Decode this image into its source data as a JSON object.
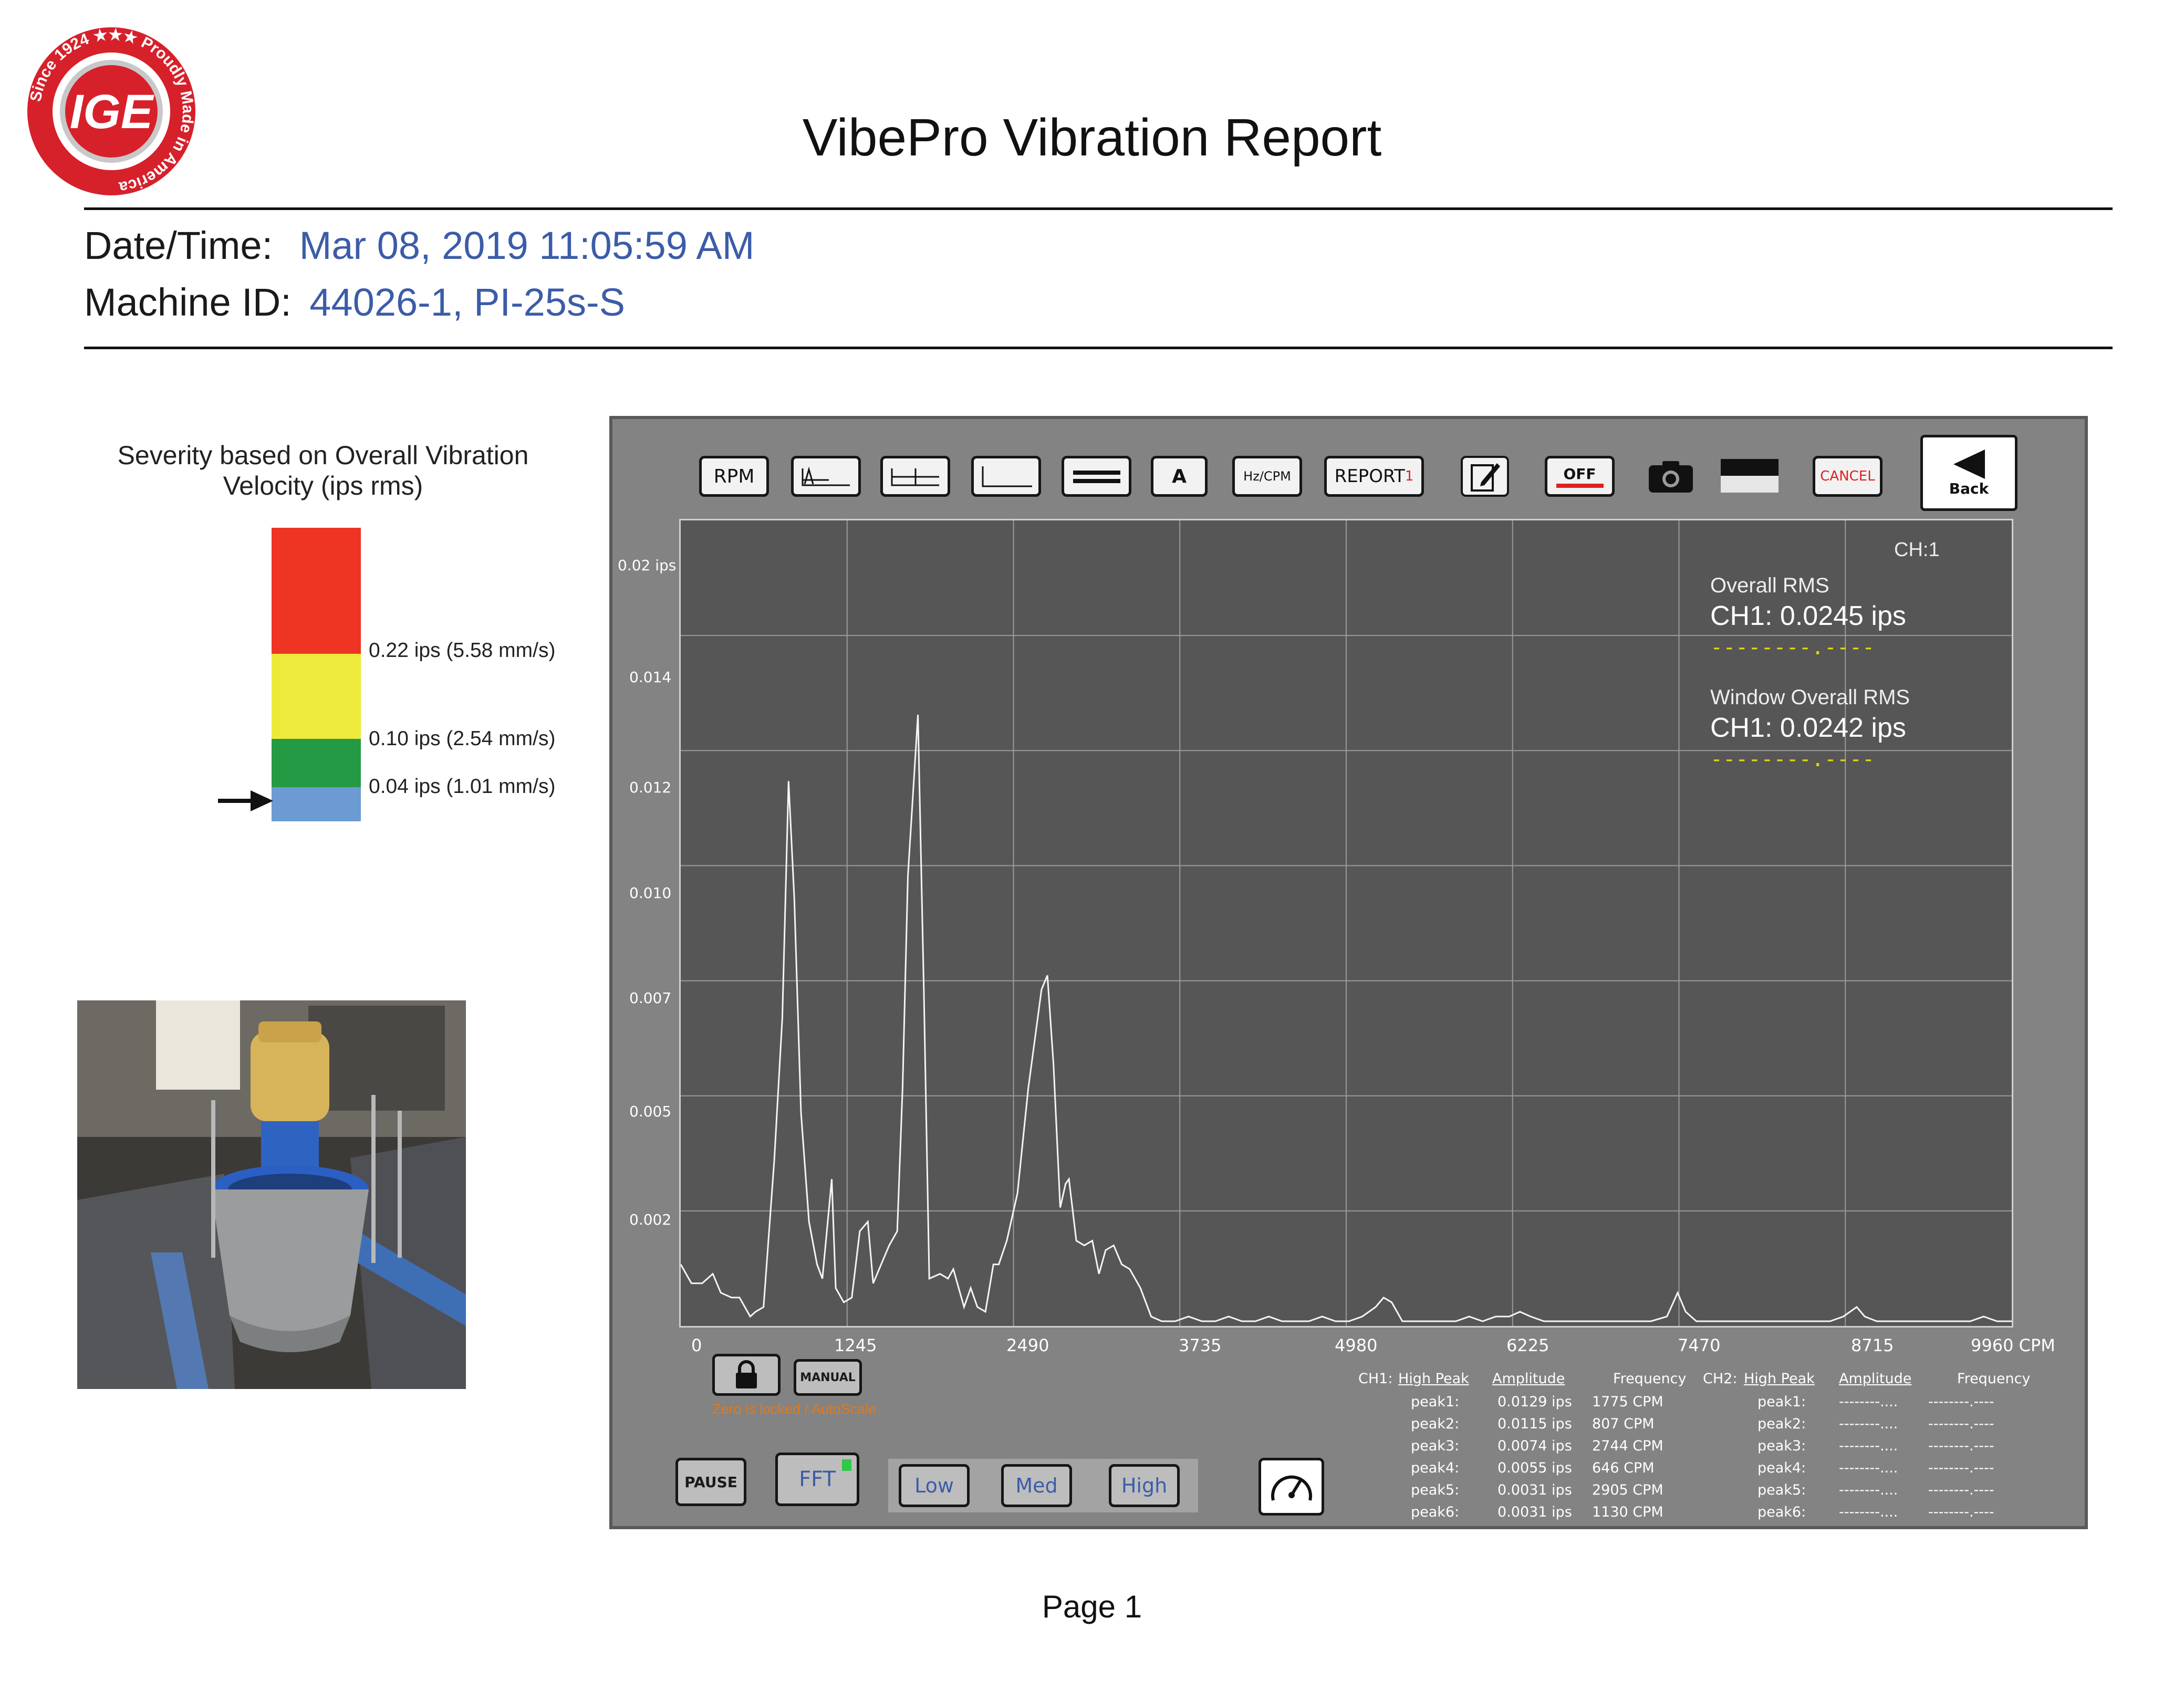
{
  "logo": {
    "brand": "IGE",
    "ring_text": "Since 1924 ★★★ Proudly Made in America"
  },
  "title": "VibePro Vibration Report",
  "meta": {
    "date_label": "Date/Time:",
    "date_value": "Mar 08, 2019  11:05:59 AM",
    "machine_label": "Machine ID:",
    "machine_value": "44026-1, PI-25s-S"
  },
  "severity": {
    "title": "Severity based on Overall Vibration Velocity (ips rms)",
    "thresholds": [
      {
        "label": "0.22 ips (5.58 mm/s)"
      },
      {
        "label": "0.10 ips (2.54 mm/s)"
      },
      {
        "label": "0.04 ips (1.01 mm/s)"
      }
    ],
    "colors": {
      "red": "#ee3423",
      "yellow": "#eeea3c",
      "green": "#249a45",
      "blue": "#6b9bd2"
    },
    "current_band": "blue"
  },
  "toolbar": {
    "rpm": "RPM",
    "a": "A",
    "hzcpm": "Hz/CPM",
    "report": "REPORT",
    "report_badge": "1",
    "off": "OFF",
    "cancel": "CANCEL",
    "back": "Back"
  },
  "overlay": {
    "ch": "CH:1",
    "overall_title": "Overall RMS",
    "overall_value": "CH1:  0.0245 ips",
    "overall_dash": "--------.----",
    "window_title": "Window Overall RMS",
    "window_value": "CH1:  0.0242 ips",
    "window_dash": "--------.----"
  },
  "chart_data": {
    "type": "line",
    "title": "",
    "xlabel": "",
    "ylabel": "",
    "x_unit": "CPM",
    "y_unit": "ips",
    "xlim": [
      0,
      9960
    ],
    "ylim": [
      0,
      0.017
    ],
    "x_ticks": [
      "0",
      "1245",
      "2490",
      "3735",
      "4980",
      "6225",
      "7470",
      "8715",
      "9960 CPM"
    ],
    "y_ticks": [
      "0.02 ips",
      "0.014",
      "0.012",
      "0.010",
      "0.007",
      "0.005",
      "0.002"
    ],
    "series": [
      {
        "values": [
          [
            0,
            0.0013
          ],
          [
            80,
            0.0009
          ],
          [
            160,
            0.0009
          ],
          [
            240,
            0.0011
          ],
          [
            300,
            0.0007
          ],
          [
            380,
            0.0006
          ],
          [
            440,
            0.0006
          ],
          [
            520,
            0.0002
          ],
          [
            560,
            0.0003
          ],
          [
            620,
            0.0004
          ],
          [
            700,
            0.0035
          ],
          [
            760,
            0.0065
          ],
          [
            807,
            0.0115
          ],
          [
            850,
            0.009
          ],
          [
            900,
            0.0045
          ],
          [
            960,
            0.0022
          ],
          [
            1020,
            0.0013
          ],
          [
            1060,
            0.001
          ],
          [
            1130,
            0.0031
          ],
          [
            1160,
            0.0008
          ],
          [
            1220,
            0.0005
          ],
          [
            1280,
            0.0006
          ],
          [
            1340,
            0.002
          ],
          [
            1400,
            0.0022
          ],
          [
            1440,
            0.0009
          ],
          [
            1500,
            0.0013
          ],
          [
            1560,
            0.0017
          ],
          [
            1620,
            0.002
          ],
          [
            1660,
            0.005
          ],
          [
            1700,
            0.0095
          ],
          [
            1775,
            0.0129
          ],
          [
            1820,
            0.007
          ],
          [
            1860,
            0.001
          ],
          [
            1940,
            0.0011
          ],
          [
            2000,
            0.001
          ],
          [
            2040,
            0.0012
          ],
          [
            2080,
            0.0008
          ],
          [
            2120,
            0.0004
          ],
          [
            2170,
            0.0008
          ],
          [
            2220,
            0.0004
          ],
          [
            2280,
            0.0003
          ],
          [
            2340,
            0.0013
          ],
          [
            2380,
            0.0013
          ],
          [
            2440,
            0.0018
          ],
          [
            2520,
            0.0028
          ],
          [
            2600,
            0.005
          ],
          [
            2700,
            0.0071
          ],
          [
            2744,
            0.0074
          ],
          [
            2790,
            0.0055
          ],
          [
            2840,
            0.0025
          ],
          [
            2880,
            0.003
          ],
          [
            2905,
            0.0031
          ],
          [
            2960,
            0.0018
          ],
          [
            3020,
            0.0017
          ],
          [
            3080,
            0.0018
          ],
          [
            3130,
            0.0011
          ],
          [
            3180,
            0.0016
          ],
          [
            3240,
            0.0017
          ],
          [
            3300,
            0.0013
          ],
          [
            3360,
            0.0012
          ],
          [
            3440,
            0.0008
          ],
          [
            3520,
            0.0002
          ],
          [
            3600,
            0.0001
          ],
          [
            3700,
            0.0001
          ],
          [
            3800,
            0.0002
          ],
          [
            3900,
            0.0001
          ],
          [
            4000,
            0.0001
          ],
          [
            4100,
            0.0002
          ],
          [
            4200,
            0.0001
          ],
          [
            4300,
            0.0001
          ],
          [
            4400,
            0.0002
          ],
          [
            4500,
            0.0001
          ],
          [
            4600,
            0.0001
          ],
          [
            4700,
            0.0001
          ],
          [
            4800,
            0.0002
          ],
          [
            4900,
            0.0001
          ],
          [
            5000,
            0.0001
          ],
          [
            5100,
            0.0002
          ],
          [
            5200,
            0.0004
          ],
          [
            5260,
            0.0006
          ],
          [
            5320,
            0.0005
          ],
          [
            5400,
            0.0001
          ],
          [
            5500,
            0.0001
          ],
          [
            5600,
            0.0001
          ],
          [
            5700,
            0.0001
          ],
          [
            5800,
            0.0001
          ],
          [
            5900,
            0.0002
          ],
          [
            6000,
            0.0001
          ],
          [
            6100,
            0.0002
          ],
          [
            6200,
            0.0002
          ],
          [
            6280,
            0.0003
          ],
          [
            6360,
            0.0002
          ],
          [
            6460,
            0.0001
          ],
          [
            6560,
            0.0001
          ],
          [
            6660,
            0.0001
          ],
          [
            6760,
            0.0001
          ],
          [
            6860,
            0.0001
          ],
          [
            6960,
            0.0001
          ],
          [
            7060,
            0.0001
          ],
          [
            7160,
            0.0001
          ],
          [
            7260,
            0.0001
          ],
          [
            7380,
            0.0002
          ],
          [
            7460,
            0.0007
          ],
          [
            7520,
            0.0003
          ],
          [
            7600,
            0.0001
          ],
          [
            7700,
            0.0001
          ],
          [
            7800,
            0.0001
          ],
          [
            7900,
            0.0001
          ],
          [
            8000,
            0.0001
          ],
          [
            8100,
            0.0001
          ],
          [
            8200,
            0.0001
          ],
          [
            8300,
            0.0001
          ],
          [
            8400,
            0.0001
          ],
          [
            8500,
            0.0001
          ],
          [
            8600,
            0.0001
          ],
          [
            8700,
            0.0002
          ],
          [
            8800,
            0.0004
          ],
          [
            8860,
            0.0002
          ],
          [
            8950,
            0.0001
          ],
          [
            9050,
            0.0001
          ],
          [
            9150,
            0.0001
          ],
          [
            9250,
            0.0001
          ],
          [
            9350,
            0.0001
          ],
          [
            9450,
            0.0001
          ],
          [
            9550,
            0.0001
          ],
          [
            9650,
            0.0001
          ],
          [
            9750,
            0.0002
          ],
          [
            9850,
            0.0001
          ],
          [
            9960,
            0.0001
          ]
        ]
      }
    ],
    "grid": true
  },
  "controls": {
    "manual": "MANUAL",
    "zero_note": "Zero is locked / AutoScale",
    "pause": "PAUSE",
    "fft": "FFT",
    "low": "Low",
    "med": "Med",
    "high": "High"
  },
  "peaks": {
    "ch1_label": "CH1:",
    "ch2_label": "CH2:",
    "col_high_peak": "High Peak",
    "col_amplitude": "Amplitude",
    "col_frequency": "Frequency",
    "ch1": [
      {
        "name": "peak1:",
        "amp": "0.0129 ips",
        "freq": "1775 CPM"
      },
      {
        "name": "peak2:",
        "amp": "0.0115 ips",
        "freq": "807 CPM"
      },
      {
        "name": "peak3:",
        "amp": "0.0074 ips",
        "freq": "2744 CPM"
      },
      {
        "name": "peak4:",
        "amp": "0.0055 ips",
        "freq": "646 CPM"
      },
      {
        "name": "peak5:",
        "amp": "0.0031 ips",
        "freq": "2905 CPM"
      },
      {
        "name": "peak6:",
        "amp": "0.0031 ips",
        "freq": "1130 CPM"
      }
    ],
    "ch2": [
      {
        "name": "peak1:",
        "amp": "--------....",
        "freq": "--------.----"
      },
      {
        "name": "peak2:",
        "amp": "--------....",
        "freq": "--------.----"
      },
      {
        "name": "peak3:",
        "amp": "--------....",
        "freq": "--------.----"
      },
      {
        "name": "peak4:",
        "amp": "--------....",
        "freq": "--------.----"
      },
      {
        "name": "peak5:",
        "amp": "--------....",
        "freq": "--------.----"
      },
      {
        "name": "peak6:",
        "amp": "--------....",
        "freq": "--------.----"
      }
    ]
  },
  "footer": {
    "page": "Page 1"
  }
}
